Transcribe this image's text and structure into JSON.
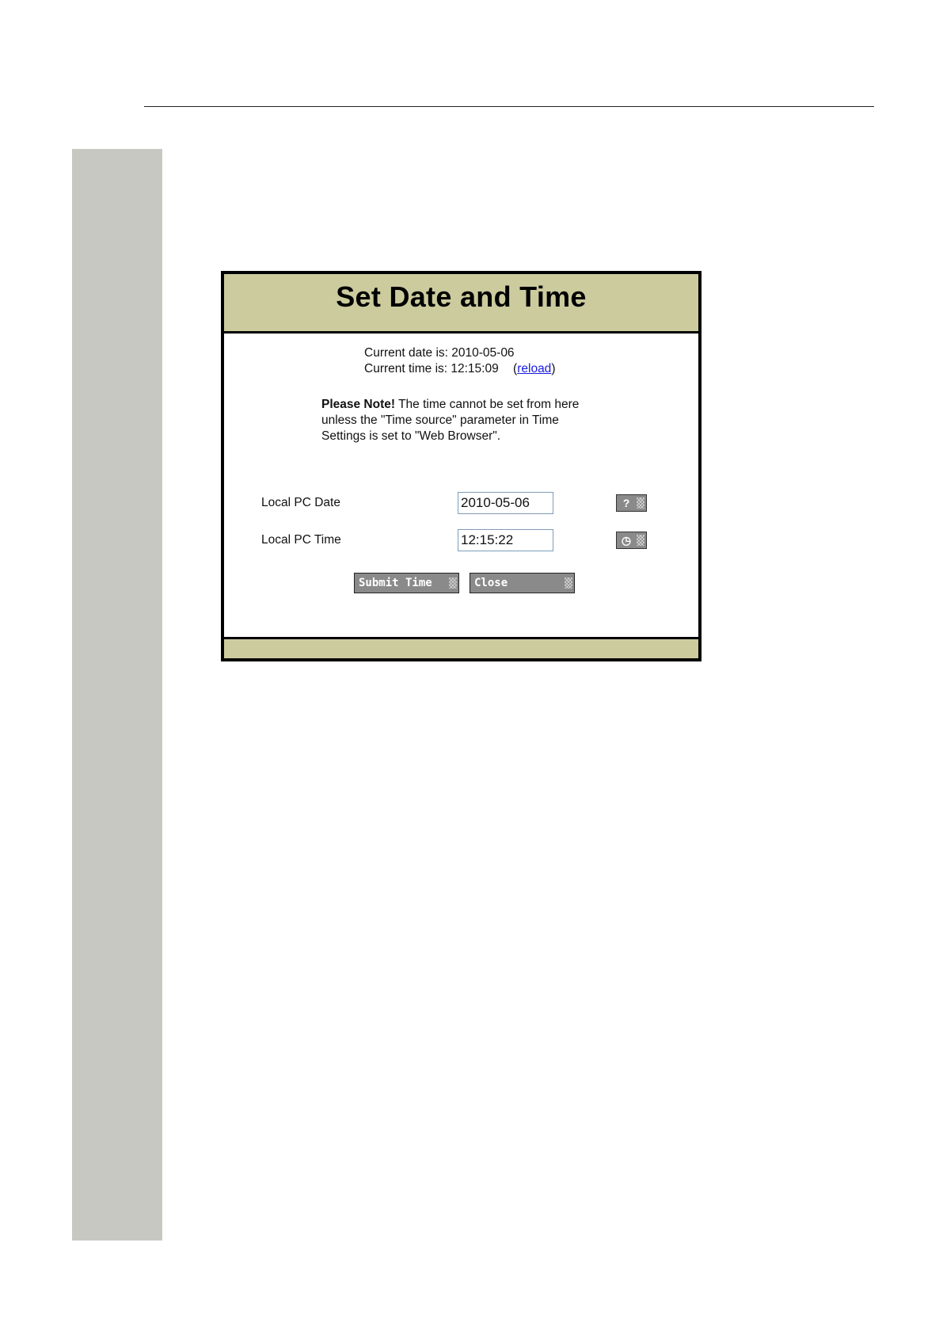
{
  "dialog": {
    "title": "Set Date and Time",
    "current_date_text": "Current date is: 2010-05-06",
    "current_time_text": "Current time is: 12:15:09",
    "reload_open": "(",
    "reload_label": "reload",
    "reload_close": ")",
    "note_bold": "Please Note!",
    "note_text": " The time cannot be set from here unless the \"Time source\" parameter in Time Settings is set to \"Web Browser\".",
    "local_date_label": "Local PC Date",
    "local_date_value": "2010-05-06",
    "local_time_label": "Local PC Time",
    "local_time_value": "12:15:22",
    "date_picker_glyph": "?",
    "time_picker_glyph": "◷",
    "submit_label": "Submit Time",
    "close_label": "Close"
  },
  "icons": {
    "date_picker": "question-icon",
    "time_picker": "clock-icon"
  },
  "colors": {
    "header_bg": "#cbcb9e",
    "side_band": "#c8c8c2",
    "button_bg": "#8a8a8a",
    "link": "#1a1adf"
  }
}
